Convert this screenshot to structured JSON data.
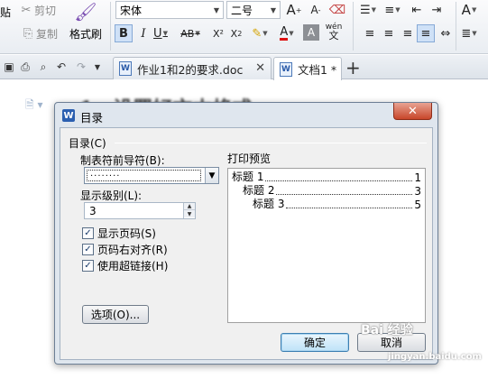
{
  "ribbon": {
    "cut_label": "剪切",
    "copy_label": "复制",
    "format_painter_label": "格式刷",
    "paste_label_partial": "贴",
    "font_name": "宋体",
    "font_size": "二号",
    "bold": "B",
    "italic": "I",
    "underline": "U",
    "strikethrough": "AB",
    "superscript": "X²",
    "subscript": "X",
    "subscript_small": "2",
    "grow_font": "A",
    "shrink_font": "A",
    "font_color": "A",
    "char_shading": "A",
    "phonetic": "wén",
    "phonetic_char": "文",
    "styles": "A"
  },
  "tabs": [
    {
      "label": "作业1和2的要求.doc",
      "active": false
    },
    {
      "label": "文档1 *",
      "active": true
    }
  ],
  "new_tab_symbol": "+",
  "document": {
    "heading": "1、设置好文本格式"
  },
  "dialog": {
    "logo_letter": "W",
    "title": "目录",
    "close_symbol": "✕",
    "group_label": "目录(C)",
    "leader_label": "制表符前导符(B):",
    "leader_value": "........",
    "levels_label": "显示级别(L):",
    "levels_value": "3",
    "show_page_numbers": {
      "label": "显示页码(S)",
      "checked": true
    },
    "right_align": {
      "label": "页码右对齐(R)",
      "checked": true
    },
    "use_hyperlinks": {
      "label": "使用超链接(H)",
      "checked": true
    },
    "options_button": "选项(O)...",
    "preview_label": "打印预览",
    "preview_lines": [
      {
        "text": "标题 1",
        "page": "1"
      },
      {
        "text": "标题 2",
        "page": "3"
      },
      {
        "text": "标题 3",
        "page": "5"
      }
    ],
    "ok_button": "确定",
    "cancel_button": "取消"
  },
  "watermark": {
    "main": "Bai 经验",
    "sub": "jingyan.baidu.com"
  },
  "colors": {
    "ribbon_bg": "#e9edf2",
    "dialog_frame": "#dfe6ee",
    "close_red": "#c7462a",
    "accent_blue": "#2b5fb0"
  }
}
